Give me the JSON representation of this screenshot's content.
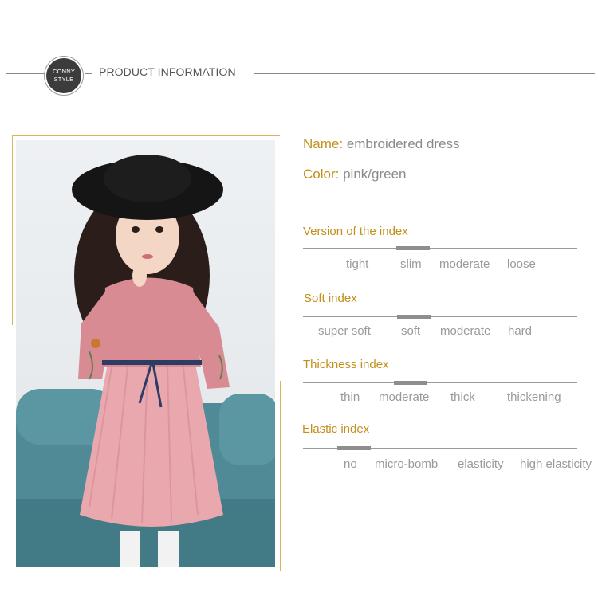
{
  "header": {
    "logo_line1": "CONNY",
    "logo_line2": "STYLE",
    "title": "PRODUCT INFORMATION"
  },
  "specs": {
    "name_label": "Name:",
    "name_value": "embroidered dress",
    "color_label": "Color:",
    "color_value": "pink/green"
  },
  "indexes": [
    {
      "title": "Version of the index",
      "options": [
        "tight",
        "slim",
        "moderate",
        "loose"
      ],
      "selected": "slim"
    },
    {
      "title": "Soft index",
      "options": [
        "super soft",
        "soft",
        "moderate",
        "hard"
      ],
      "selected": "soft"
    },
    {
      "title": "Thickness index",
      "options": [
        "thin",
        "moderate",
        "thick",
        "thickening"
      ],
      "selected": "moderate"
    },
    {
      "title": "Elastic index",
      "options": [
        "no",
        "micro-bomb",
        "elasticity",
        "high elasticity"
      ],
      "selected": "no"
    }
  ],
  "colors": {
    "accent": "#c28f1b",
    "text_gray": "#8a8a8a",
    "frame_gold": "#d8b45a"
  }
}
